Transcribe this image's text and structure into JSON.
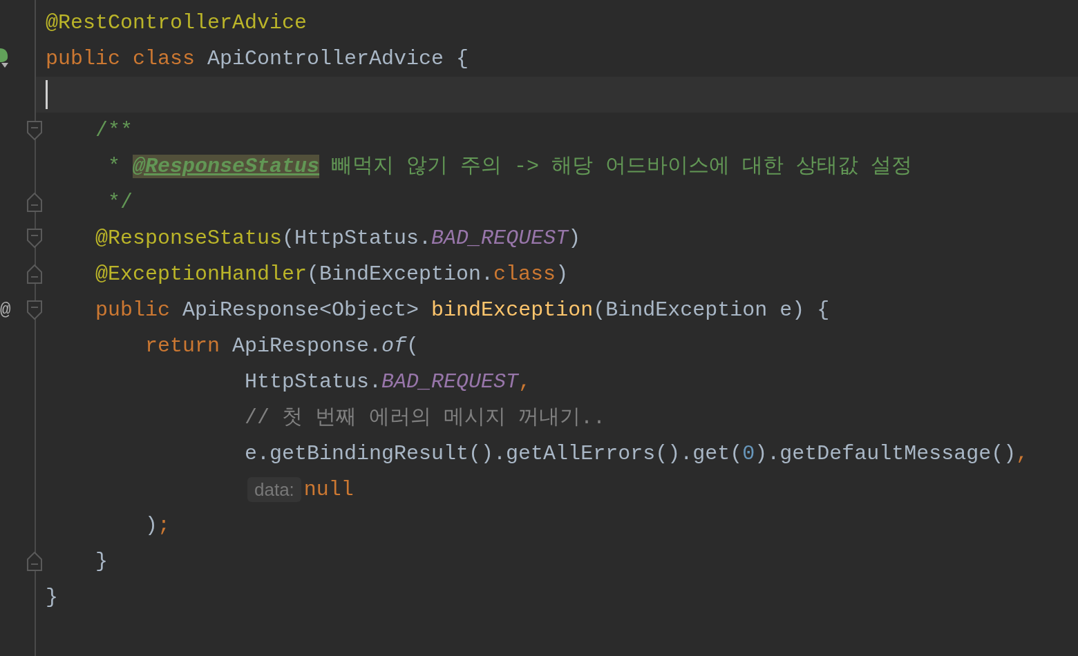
{
  "lines": [
    {
      "bean": false,
      "fold_start": false,
      "fold_end": false,
      "current": false,
      "tokens": [
        {
          "kind": "annotation",
          "text": "@RestControllerAdvice"
        }
      ]
    },
    {
      "bean": true,
      "fold_start": false,
      "fold_end": false,
      "current": false,
      "tokens": [
        {
          "kind": "keyword",
          "text": "public class "
        },
        {
          "kind": "plain",
          "text": "ApiControllerAdvice {"
        }
      ]
    },
    {
      "bean": false,
      "fold_start": false,
      "fold_end": false,
      "current": true
    },
    {
      "bean": false,
      "fold_start": true,
      "fold_end": false,
      "current": false,
      "tokens": [
        {
          "kind": "doc",
          "text": "    /**"
        }
      ]
    },
    {
      "bean": false,
      "fold_start": false,
      "fold_end": false,
      "current": false,
      "tokens": [
        {
          "kind": "doc",
          "text": "     * "
        },
        {
          "kind": "doctag",
          "text": "@ResponseStatus"
        },
        {
          "kind": "doc",
          "text": " 빼먹지 않기 주의 -> 해당 어드바이스에 대한 상태값 설정"
        }
      ]
    },
    {
      "bean": false,
      "fold_start": false,
      "fold_end": true,
      "current": false,
      "tokens": [
        {
          "kind": "doc",
          "text": "     */"
        }
      ]
    },
    {
      "bean": false,
      "fold_start": true,
      "fold_end": false,
      "current": false,
      "tokens": [
        {
          "kind": "annotation",
          "text": "    @ResponseStatus"
        },
        {
          "kind": "plain",
          "text": "(HttpStatus."
        },
        {
          "kind": "static",
          "text": "BAD_REQUEST"
        },
        {
          "kind": "plain",
          "text": ")"
        }
      ]
    },
    {
      "bean": false,
      "fold_start": false,
      "fold_end": true,
      "current": false,
      "tokens": [
        {
          "kind": "annotation",
          "text": "    @ExceptionHandler"
        },
        {
          "kind": "plain",
          "text": "(BindException."
        },
        {
          "kind": "keyword",
          "text": "class"
        },
        {
          "kind": "plain",
          "text": ")"
        }
      ]
    },
    {
      "bean": false,
      "gutter_mark": "@",
      "fold_start": true,
      "fold_end": false,
      "current": false,
      "tokens": [
        {
          "kind": "keyword",
          "text": "    public "
        },
        {
          "kind": "plain",
          "text": "ApiResponse<Object> "
        },
        {
          "kind": "method",
          "text": "bindException"
        },
        {
          "kind": "plain",
          "text": "(BindException e) {"
        }
      ]
    },
    {
      "bean": false,
      "fold_start": false,
      "fold_end": false,
      "current": false,
      "tokens": [
        {
          "kind": "keyword",
          "text": "        return "
        },
        {
          "kind": "plain",
          "text": "ApiResponse."
        },
        {
          "kind": "call",
          "text": "of"
        },
        {
          "kind": "plain",
          "text": "("
        }
      ]
    },
    {
      "bean": false,
      "fold_start": false,
      "fold_end": false,
      "current": false,
      "tokens": [
        {
          "kind": "plain",
          "text": "                HttpStatus."
        },
        {
          "kind": "static",
          "text": "BAD_REQUEST"
        },
        {
          "kind": "keyword",
          "text": ","
        }
      ]
    },
    {
      "bean": false,
      "fold_start": false,
      "fold_end": false,
      "current": false,
      "tokens": [
        {
          "kind": "comment",
          "text": "                // 첫 번째 에러의 메시지 꺼내기.."
        }
      ]
    },
    {
      "bean": false,
      "fold_start": false,
      "fold_end": false,
      "current": false,
      "tokens": [
        {
          "kind": "plain",
          "text": "                e.getBindingResult().getAllErrors().get("
        },
        {
          "kind": "number",
          "text": "0"
        },
        {
          "kind": "plain",
          "text": ").getDefaultMessage()"
        },
        {
          "kind": "keyword",
          "text": ","
        }
      ]
    },
    {
      "bean": false,
      "fold_start": false,
      "fold_end": false,
      "current": false,
      "tokens": [
        {
          "kind": "hint",
          "text": "data:"
        },
        {
          "kind": "keyword",
          "text": "null"
        }
      ]
    },
    {
      "bean": false,
      "fold_start": false,
      "fold_end": false,
      "current": false,
      "tokens": [
        {
          "kind": "plain",
          "text": "        )"
        },
        {
          "kind": "keyword",
          "text": ";"
        }
      ]
    },
    {
      "bean": false,
      "fold_start": false,
      "fold_end": true,
      "current": false,
      "tokens": [
        {
          "kind": "plain",
          "text": "    }"
        }
      ]
    },
    {
      "bean": false,
      "fold_start": false,
      "fold_end": false,
      "current": false,
      "tokens": [
        {
          "kind": "plain",
          "text": "}"
        }
      ]
    }
  ]
}
